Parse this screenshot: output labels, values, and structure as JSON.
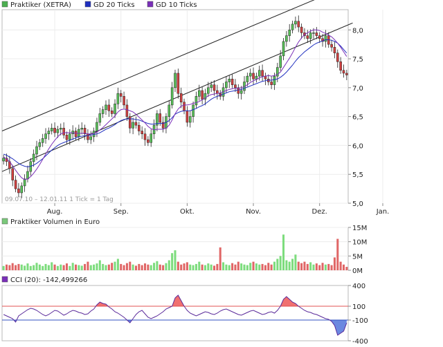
{
  "chart_data": [
    {
      "type": "candlestick",
      "legend": [
        {
          "name": "Praktiker (XETRA)",
          "color": "#4caf50"
        },
        {
          "name": "GD 20 Ticks",
          "color": "#1f2fbf"
        },
        {
          "name": "GD 10 Ticks",
          "color": "#7a2fb8"
        }
      ],
      "ylim": [
        5.0,
        8.35
      ],
      "yticks": [
        "8,0",
        "7,5",
        "7,0",
        "6,5",
        "6,0",
        "5,5",
        "5,0"
      ],
      "ytick_values": [
        8.0,
        7.5,
        7.0,
        6.5,
        6.0,
        5.5,
        5.0
      ],
      "xtick_labels": [
        "Aug.",
        "Sep.",
        "Okt.",
        "Nov.",
        "Dez.",
        "Jan."
      ],
      "xtick_index": [
        17,
        39,
        61,
        83,
        105,
        126
      ],
      "range_note": "09.07.10 – 12.01.11   1 Tick = 1 Tag",
      "close": [
        5.78,
        5.72,
        5.6,
        5.4,
        5.25,
        5.18,
        5.3,
        5.42,
        5.55,
        5.72,
        5.85,
        5.98,
        6.05,
        6.12,
        6.2,
        6.25,
        6.3,
        6.22,
        6.28,
        6.3,
        6.18,
        6.1,
        6.2,
        6.25,
        6.15,
        6.28,
        6.3,
        6.2,
        6.1,
        6.15,
        6.25,
        6.4,
        6.55,
        6.62,
        6.7,
        6.6,
        6.55,
        6.72,
        6.9,
        6.85,
        6.7,
        6.5,
        6.3,
        6.4,
        6.35,
        6.25,
        6.2,
        6.1,
        6.05,
        6.2,
        6.35,
        6.55,
        6.4,
        6.3,
        6.5,
        6.7,
        7.0,
        7.25,
        6.9,
        6.75,
        6.6,
        6.4,
        6.5,
        6.7,
        6.85,
        6.95,
        6.8,
        6.9,
        7.0,
        7.05,
        6.95,
        6.9,
        6.85,
        7.0,
        7.1,
        7.15,
        7.05,
        7.0,
        6.9,
        6.95,
        7.1,
        7.2,
        7.25,
        7.15,
        7.2,
        7.3,
        7.2,
        7.15,
        7.1,
        7.05,
        7.2,
        7.35,
        7.55,
        7.8,
        7.9,
        8.0,
        8.1,
        8.15,
        8.05,
        7.95,
        7.9,
        7.85,
        7.95,
        7.95,
        7.9,
        7.85,
        7.8,
        7.9,
        7.75,
        7.7,
        7.6,
        7.45,
        7.3,
        7.25,
        7.22
      ],
      "ma20": [
        5.85,
        5.83,
        5.8,
        5.77,
        5.73,
        5.69,
        5.66,
        5.64,
        5.63,
        5.64,
        5.66,
        5.69,
        5.73,
        5.77,
        5.82,
        5.87,
        5.92,
        5.96,
        6.0,
        6.03,
        6.05,
        6.07,
        6.09,
        6.11,
        6.13,
        6.15,
        6.16,
        6.17,
        6.17,
        6.18,
        6.19,
        6.2,
        6.22,
        6.25,
        6.28,
        6.3,
        6.33,
        6.36,
        6.4,
        6.43,
        6.45,
        6.46,
        6.46,
        6.46,
        6.45,
        6.44,
        6.42,
        6.4,
        6.38,
        6.37,
        6.37,
        6.38,
        6.38,
        6.38,
        6.4,
        6.43,
        6.48,
        6.54,
        6.57,
        6.59,
        6.6,
        6.6,
        6.6,
        6.62,
        6.64,
        6.67,
        6.69,
        6.72,
        6.76,
        6.8,
        6.83,
        6.85,
        6.87,
        6.89,
        6.91,
        6.93,
        6.94,
        6.95,
        6.96,
        6.97,
        6.99,
        7.01,
        7.03,
        7.05,
        7.07,
        7.09,
        7.11,
        7.12,
        7.13,
        7.13,
        7.14,
        7.15,
        7.18,
        7.22,
        7.27,
        7.33,
        7.39,
        7.46,
        7.52,
        7.57,
        7.62,
        7.66,
        7.7,
        7.74,
        7.77,
        7.79,
        7.81,
        7.83,
        7.83,
        7.82,
        7.8,
        7.77,
        7.72,
        7.66,
        7.6
      ],
      "ma10": [
        5.8,
        5.77,
        5.72,
        5.65,
        5.57,
        5.5,
        5.44,
        5.41,
        5.42,
        5.46,
        5.52,
        5.59,
        5.67,
        5.76,
        5.85,
        5.94,
        6.02,
        6.09,
        6.15,
        6.2,
        6.22,
        6.22,
        6.22,
        6.22,
        6.21,
        6.21,
        6.21,
        6.21,
        6.2,
        6.2,
        6.21,
        6.23,
        6.27,
        6.31,
        6.36,
        6.41,
        6.46,
        6.51,
        6.58,
        6.62,
        6.63,
        6.62,
        6.6,
        6.58,
        6.54,
        6.49,
        6.44,
        6.39,
        6.33,
        6.29,
        6.27,
        6.28,
        6.28,
        6.28,
        6.3,
        6.35,
        6.44,
        6.55,
        6.63,
        6.68,
        6.7,
        6.7,
        6.71,
        6.73,
        6.74,
        6.76,
        6.79,
        6.82,
        6.86,
        6.88,
        6.89,
        6.9,
        6.91,
        6.93,
        6.95,
        6.97,
        6.98,
        6.99,
        6.99,
        7.0,
        7.02,
        7.05,
        7.09,
        7.12,
        7.14,
        7.17,
        7.19,
        7.2,
        7.21,
        7.2,
        7.21,
        7.23,
        7.27,
        7.35,
        7.43,
        7.51,
        7.6,
        7.7,
        7.79,
        7.86,
        7.92,
        7.95,
        7.98,
        8.0,
        8.0,
        7.99,
        7.96,
        7.94,
        7.91,
        7.88,
        7.83,
        7.77,
        7.7,
        7.62,
        7.54
      ],
      "channel_lines": [
        {
          "from": [
            0,
            5.55
          ],
          "to": [
            116,
            8.12
          ]
        },
        {
          "from": [
            0,
            6.25
          ],
          "to": [
            116,
            8.8
          ]
        }
      ]
    },
    {
      "type": "bar",
      "title": "Praktiker Volumen in Euro",
      "title_color": "#7ac87a",
      "ylim": [
        0,
        15
      ],
      "yticks": [
        "15M",
        "10M",
        "5M",
        "0M"
      ],
      "ytick_values": [
        15,
        10,
        5,
        0
      ],
      "values": [
        1.5,
        2.0,
        1.8,
        2.5,
        1.8,
        2.2,
        2.0,
        1.6,
        2.4,
        1.5,
        1.8,
        2.6,
        2.0,
        1.5,
        2.2,
        1.8,
        2.8,
        2.0,
        1.5,
        2.0,
        1.8,
        2.4,
        1.5,
        2.6,
        2.0,
        1.8,
        1.6,
        2.2,
        3.0,
        1.8,
        2.0,
        2.4,
        3.5,
        2.2,
        1.8,
        2.0,
        2.6,
        3.0,
        4.0,
        2.2,
        1.8,
        2.5,
        3.0,
        2.0,
        1.6,
        2.2,
        1.8,
        2.4,
        2.0,
        1.8,
        2.6,
        3.2,
        2.0,
        1.8,
        2.5,
        3.5,
        6.0,
        7.0,
        3.0,
        2.0,
        2.4,
        2.8,
        2.0,
        1.8,
        2.2,
        3.0,
        2.0,
        1.8,
        2.4,
        2.0,
        1.6,
        2.2,
        8.0,
        2.8,
        2.0,
        1.8,
        2.5,
        2.0,
        3.0,
        2.4,
        2.0,
        1.8,
        2.6,
        3.0,
        2.4,
        2.0,
        2.2,
        1.8,
        2.6,
        2.0,
        3.0,
        4.0,
        5.0,
        12.5,
        3.5,
        3.0,
        4.0,
        5.5,
        3.0,
        2.5,
        3.0,
        2.2,
        2.8,
        2.0,
        2.4,
        1.8,
        2.6,
        2.0,
        2.2,
        1.8,
        4.5,
        11.0,
        3.0,
        2.0,
        1.2
      ],
      "up_color": "#7ddc7d",
      "down_color": "#e06666"
    },
    {
      "type": "line",
      "title": "CCI (20): -142,499266",
      "ylim": [
        -400,
        400
      ],
      "yticks": [
        "400",
        "100",
        "-100",
        "-400"
      ],
      "ytick_values": [
        400,
        100,
        -100,
        -400
      ],
      "upper_band": 100,
      "lower_band": -100,
      "values": [
        -20,
        -40,
        -60,
        -80,
        -130,
        -40,
        -10,
        20,
        50,
        70,
        60,
        40,
        10,
        -20,
        -40,
        -20,
        10,
        40,
        30,
        0,
        -30,
        -10,
        20,
        40,
        30,
        10,
        0,
        -20,
        -10,
        30,
        60,
        120,
        160,
        140,
        130,
        90,
        60,
        20,
        0,
        -30,
        -60,
        -100,
        -140,
        -80,
        -20,
        20,
        40,
        -10,
        -60,
        -80,
        -60,
        -40,
        -10,
        20,
        60,
        80,
        100,
        220,
        260,
        180,
        100,
        40,
        0,
        -20,
        -40,
        -20,
        0,
        20,
        10,
        -10,
        -20,
        0,
        30,
        50,
        60,
        40,
        20,
        0,
        -20,
        -30,
        -10,
        10,
        30,
        40,
        20,
        0,
        -20,
        -10,
        10,
        20,
        0,
        40,
        100,
        200,
        240,
        200,
        160,
        140,
        100,
        70,
        40,
        20,
        10,
        -10,
        -20,
        -40,
        -60,
        -80,
        -90,
        -120,
        -180,
        -320,
        -290,
        -260,
        -142
      ]
    }
  ]
}
